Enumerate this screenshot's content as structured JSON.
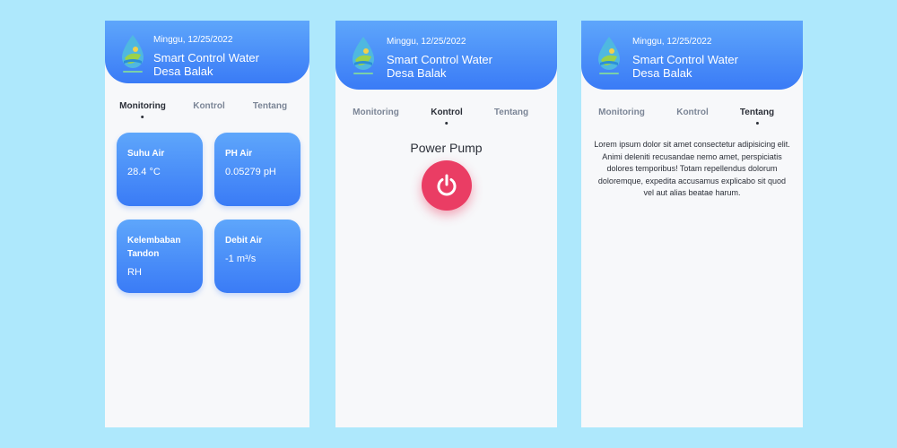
{
  "app": {
    "date": "Minggu, 12/25/2022",
    "title_line1": "Smart Control Water",
    "title_line2": "Desa Balak"
  },
  "tabs": [
    "Monitoring",
    "Kontrol",
    "Tentang"
  ],
  "monitoring": {
    "cards": [
      {
        "label": "Suhu Air",
        "value": "28.4 °C"
      },
      {
        "label": "PH Air",
        "value": "0.05279 pH"
      },
      {
        "label": "Kelembaban Tandon",
        "value": "RH"
      },
      {
        "label": "Debit Air",
        "value": "-1 m³/s"
      }
    ]
  },
  "kontrol": {
    "pump_label": "Power Pump",
    "pump_icon": "power-icon"
  },
  "tentang": {
    "text": "Lorem ipsum dolor sit amet consectetur adipisicing elit. Animi deleniti recusandae nemo amet, perspiciatis dolores temporibus! Totam repellendus dolorum doloremque, expedita accusamus explicabo sit quod vel aut alias beatae harum."
  },
  "colors": {
    "background": "#aee8fc",
    "header_top": "#5ea6fb",
    "header_bottom": "#3a7bf6",
    "power_button": "#ea3d64"
  }
}
